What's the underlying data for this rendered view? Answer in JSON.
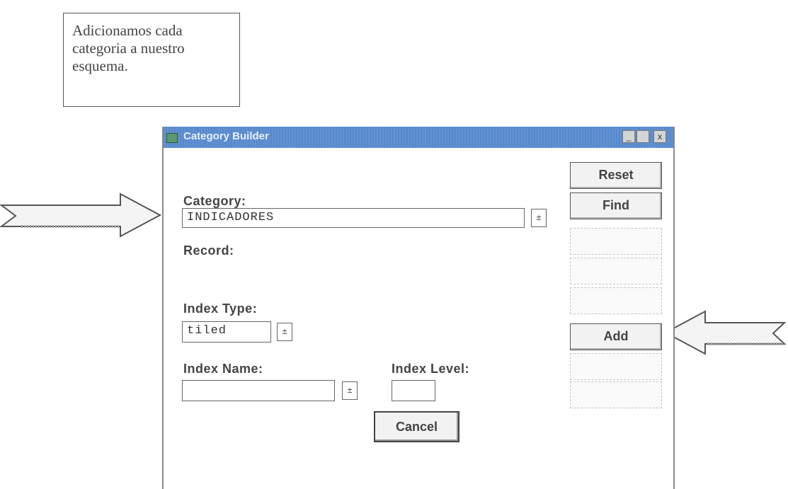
{
  "note": {
    "lines": [
      "Adicionamos cada",
      "categoria a nuestro",
      "esquema."
    ]
  },
  "window": {
    "title": "Category Builder",
    "controls": {
      "minimize": "_",
      "maximize": "",
      "close": "x"
    }
  },
  "form": {
    "category_label": "Category:",
    "category_value": "INDICADORES",
    "record_label": "Record:",
    "index_type_label": "Index Type:",
    "index_type_value": "tiled",
    "index_name_label": "Index Name:",
    "index_name_value": "",
    "index_level_label": "Index Level:",
    "index_level_value": "",
    "dropdown_glyph": "±"
  },
  "buttons": {
    "reset": "Reset",
    "find": "Find",
    "b3": "",
    "b4": "",
    "b5": "",
    "add": "Add",
    "b7": "",
    "b8": "",
    "cancel": "Cancel"
  },
  "colors": {
    "titlebar": "#4f82c8",
    "arrow_fill": "#f4f4f4",
    "arrow_stroke": "#555555"
  }
}
